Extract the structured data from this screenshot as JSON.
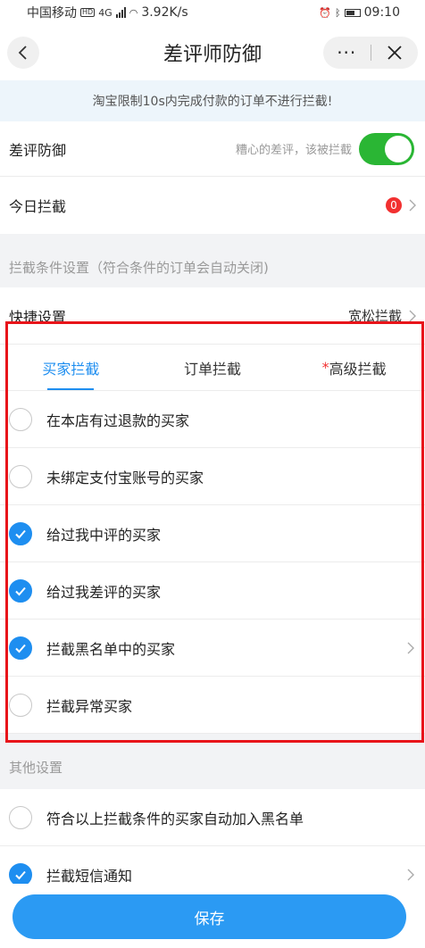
{
  "status_bar": {
    "carrier": "中国移动",
    "hd": "HD",
    "net_type": "4G",
    "speed": "3.92K/s",
    "time": "09:10"
  },
  "nav": {
    "title": "差评师防御",
    "more": "···"
  },
  "notice": "淘宝限制10s内完成付款的订单不进行拦截!",
  "defense": {
    "label": "差评防御",
    "hint": "糟心的差评，该被拦截",
    "enabled": true,
    "toggle_color": "#2ab634"
  },
  "today": {
    "label": "今日拦截",
    "count": "0"
  },
  "section_conditions": "拦截条件设置（符合条件的订单会自动关闭)",
  "quick": {
    "label": "快捷设置",
    "value": "宽松拦截"
  },
  "tabs": [
    {
      "label": "买家拦截",
      "active": true
    },
    {
      "label": "订单拦截",
      "active": false
    },
    {
      "star": "*",
      "label": "高级拦截",
      "active": false
    }
  ],
  "buyer_options": [
    {
      "label": "在本店有过退款的买家",
      "checked": false
    },
    {
      "label": "未绑定支付宝账号的买家",
      "checked": false
    },
    {
      "label": "给过我中评的买家",
      "checked": true
    },
    {
      "label": "给过我差评的买家",
      "checked": true
    },
    {
      "label": "拦截黑名单中的买家",
      "checked": true,
      "has_arrow": true
    },
    {
      "label": "拦截异常买家",
      "checked": false
    }
  ],
  "section_other": "其他设置",
  "other_options": [
    {
      "label": "符合以上拦截条件的买家自动加入黑名单",
      "checked": false
    },
    {
      "label": "拦截短信通知",
      "checked": true,
      "has_arrow": true
    }
  ],
  "save_label": "保存",
  "colors": {
    "accent": "#1e8ef0",
    "save": "#2b9af3",
    "highlight": "#e8141a",
    "badge": "#f23030"
  }
}
